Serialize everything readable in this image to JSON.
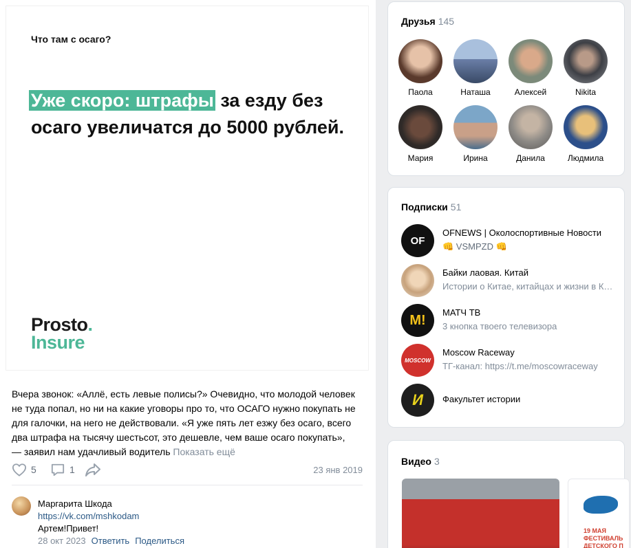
{
  "post": {
    "image": {
      "kicker": "Что там с осаго?",
      "headline_highlight": "Уже скоро: штрафы",
      "headline_rest": " за езду без осаго увеличатся до 5000 рублей.",
      "logo_line1": "Prosto",
      "logo_dot": ".",
      "logo_line2": "Insure"
    },
    "text": "Вчера звонок: «Аллё, есть левые полисы?» Очевидно, что молодой человек не туда попал, но ни на какие уговоры про то, что ОСАГО нужно покупать не для галочки, на него не действовали. «Я уже пять лет езжу без осаго, всего два штрафа на тысячу шестьсот, это дешевле, чем ваше осаго покупать», — заявил нам удачливый водитель",
    "show_more": "Показать ещё",
    "likes": "5",
    "comments": "1",
    "date": "23 янв 2019",
    "comment": {
      "author": "Маргарита Шкода",
      "link": "https://vk.com/mshkodam",
      "text": "Артем!Привет!",
      "date": "28 окт 2023",
      "reply": "Ответить",
      "share": "Поделиться"
    }
  },
  "friends": {
    "title": "Друзья",
    "count": "145",
    "items": [
      {
        "name": "Паола",
        "color": "#5a3a2c"
      },
      {
        "name": "Наташа",
        "color": "#6b7fa8"
      },
      {
        "name": "Алексей",
        "color": "#7c8a7a"
      },
      {
        "name": "Nikita",
        "color": "#3d3f45"
      },
      {
        "name": "Мария",
        "color": "#2f2a28"
      },
      {
        "name": "Ирина",
        "color": "#4a6d8c"
      },
      {
        "name": "Данила",
        "color": "#8d8a86"
      },
      {
        "name": "Людмила",
        "color": "#2c4f8a"
      }
    ]
  },
  "subscriptions": {
    "title": "Подписки",
    "count": "51",
    "items": [
      {
        "name": "OFNEWS | Околоспортивные Новости",
        "desc": "👊 VSMPZD 👊",
        "avatar_text": "OF",
        "color": "#111111"
      },
      {
        "name": "Байки лаовая. Китай",
        "desc": "Истории о Китае, китайцах и жизни в Китае",
        "avatar_text": "",
        "color": "#d9c4a8"
      },
      {
        "name": "МАТЧ ТВ",
        "desc": "3 кнопка твоего телевизора",
        "avatar_text": "M!",
        "color": "#111111"
      },
      {
        "name": "Moscow Raceway",
        "desc": "ТГ-канал: https://t.me/moscowraceway",
        "avatar_text": "MOSCOW",
        "color": "#d0312d"
      },
      {
        "name": "Факультет истории",
        "desc": "",
        "avatar_text": "И",
        "color": "#1e1e1e"
      }
    ]
  },
  "video": {
    "title": "Видео",
    "count": "3",
    "thumb2_caption": "19 МАЯ ФЕСТИВАЛЬ ДЕТСКОГО П"
  }
}
